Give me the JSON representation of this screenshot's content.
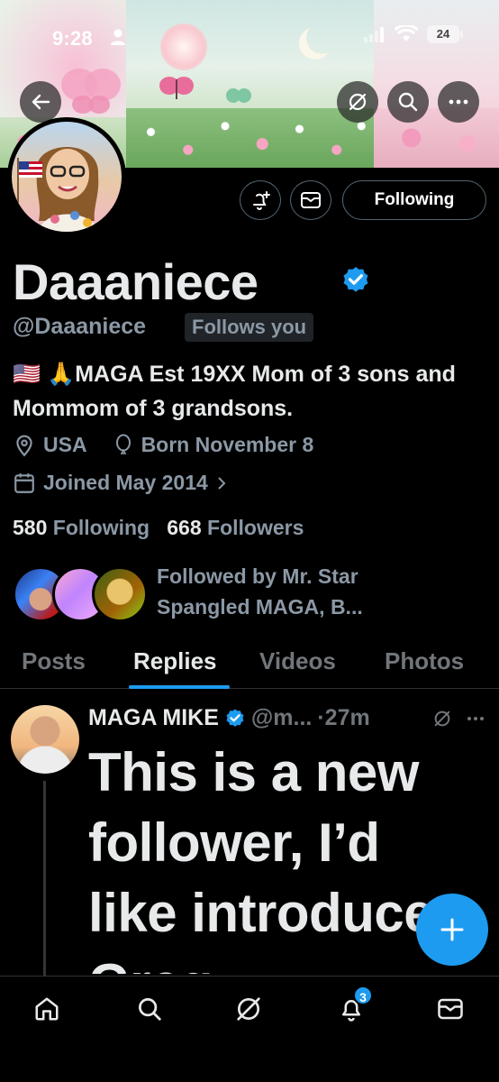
{
  "status_bar": {
    "time": "9:28",
    "battery": "24"
  },
  "profile": {
    "display_name": "Daaaniece",
    "handle": "@Daaaniece",
    "follows_you": "Follows you",
    "bio_flag": "🇺🇸 🙏",
    "bio": "MAGA Est 19XX Mom of 3 sons and Mommom of 3 grandsons.",
    "location": "USA",
    "born": "Born November 8",
    "joined": "Joined May 2014",
    "following_count": "580",
    "following_label": "Following",
    "followers_count": "668",
    "followers_label": "Followers",
    "followed_by": "Followed by Mr. Star Spangled MAGA, B...",
    "follow_button": "Following"
  },
  "tabs": [
    "Posts",
    "Replies",
    "Videos",
    "Photos"
  ],
  "active_tab": "Replies",
  "tweet": {
    "author": "MAGA MIKE",
    "handle": "@m...",
    "time": "·27m",
    "text": "This is a new follower, I’d like introduce Greg"
  },
  "bottom_nav": {
    "notifications_badge": "3"
  },
  "colors": {
    "accent": "#1d9bf0",
    "background": "#000000",
    "secondary_text": "#8b98a5"
  }
}
